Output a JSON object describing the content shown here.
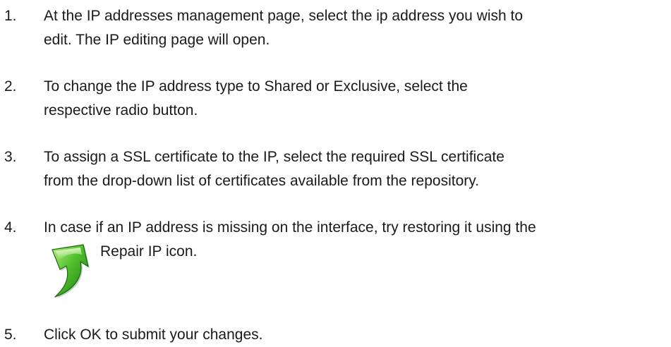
{
  "steps": [
    {
      "number": "1.",
      "lines": [
        "At the IP addresses management page, select the ip address you wish to",
        "edit. The IP editing page will open."
      ]
    },
    {
      "number": "2.",
      "lines": [
        "To change the IP address type to Shared or Exclusive, select the",
        "respective radio button."
      ]
    },
    {
      "number": "3.",
      "lines": [
        "To assign a SSL certificate to the IP, select the required SSL certificate",
        "from the drop-down list of certificates available from the repository."
      ]
    },
    {
      "number": "4.",
      "lines": [
        "In case if an IP address is missing on the interface, try restoring it using the"
      ],
      "icon_name": "repair-ip-icon",
      "icon_label": "Repair IP icon.",
      "icon_colors": [
        "#2f8f1f",
        "#4fbf2a",
        "#9be060"
      ]
    },
    {
      "number": "5.",
      "lines": [
        "Click OK to submit your changes."
      ]
    }
  ]
}
